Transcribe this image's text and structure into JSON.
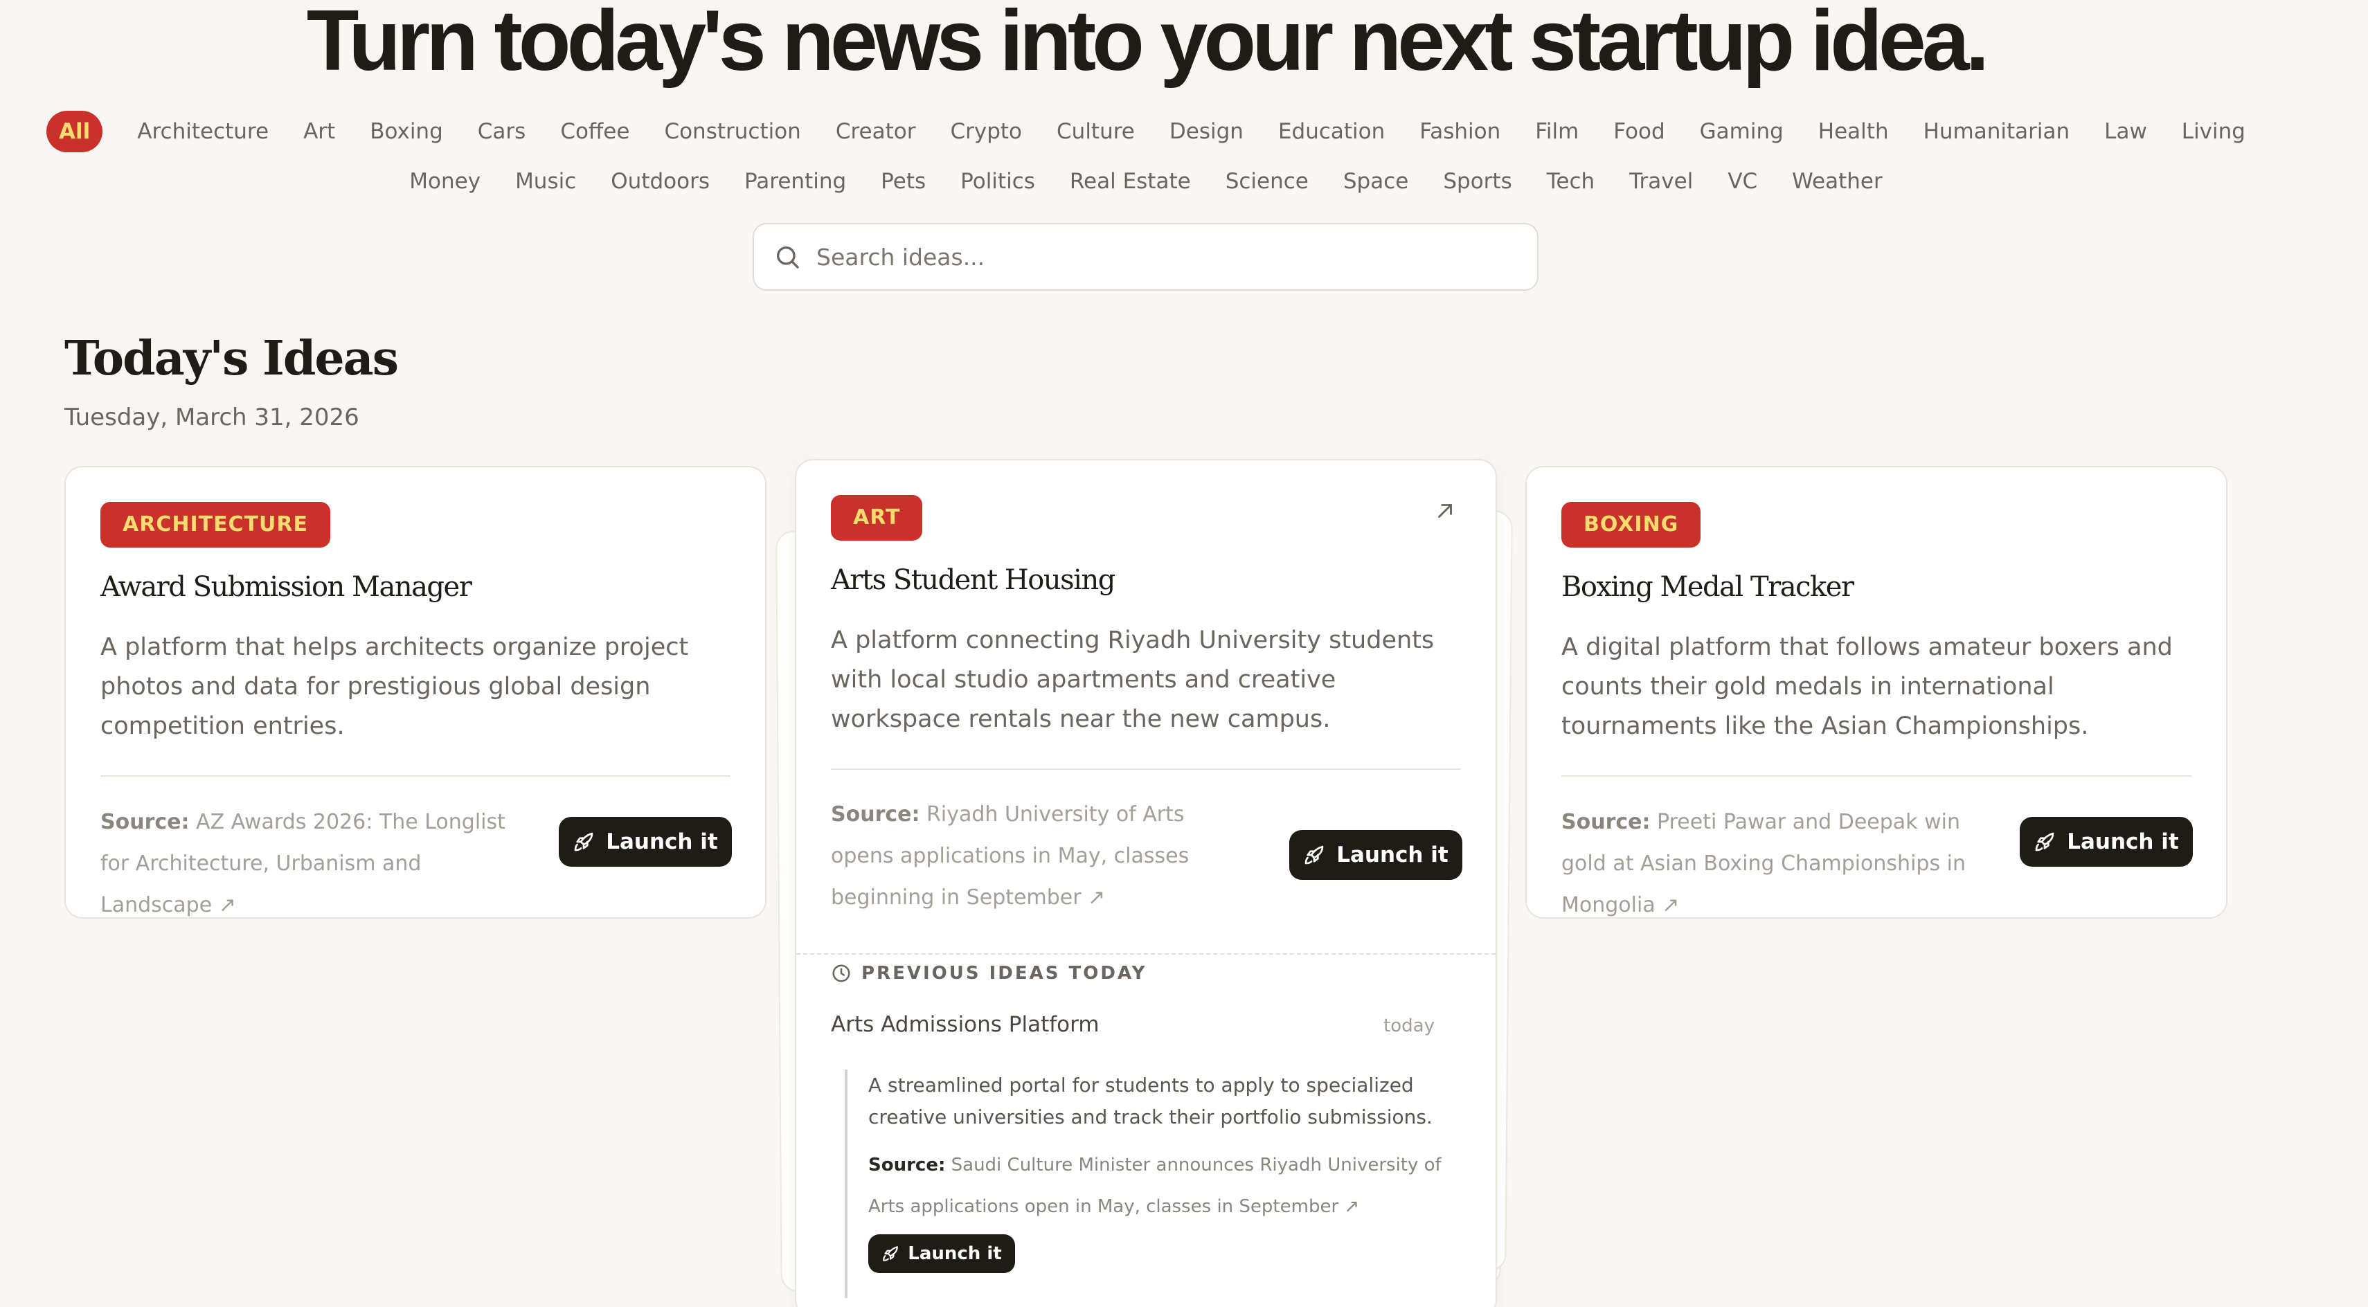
{
  "hero": {
    "title": "Turn today's news into your next startup idea."
  },
  "filters": {
    "row1": [
      "All",
      "Architecture",
      "Art",
      "Boxing",
      "Cars",
      "Coffee",
      "Construction",
      "Creator",
      "Crypto",
      "Culture",
      "Design",
      "Education",
      "Fashion",
      "Film",
      "Food",
      "Gaming",
      "Health",
      "Humanitarian",
      "Law",
      "Living"
    ],
    "row2": [
      "Money",
      "Music",
      "Outdoors",
      "Parenting",
      "Pets",
      "Politics",
      "Real Estate",
      "Science",
      "Space",
      "Sports",
      "Tech",
      "Travel",
      "VC",
      "Weather"
    ],
    "active": "All"
  },
  "search": {
    "placeholder": "Search ideas...",
    "value": ""
  },
  "section": {
    "title": "Today's Ideas",
    "date": "Tuesday, March 31, 2026"
  },
  "source_label": "Source:",
  "launch_label": "Launch it",
  "cards": [
    {
      "badge": "ARCHITECTURE",
      "title": "Award Submission Manager",
      "description": "A platform that helps architects organize project photos and data for prestigious global design competition entries.",
      "source": "AZ Awards 2026: The Longlist for Architecture, Urbanism and Landscape ↗"
    },
    {
      "badge": "ART",
      "title": "Arts Student Housing",
      "description": "A platform connecting Riyadh University students with local studio apartments and creative workspace rentals near the new campus.",
      "source": "Riyadh University of Arts opens applications in May, classes beginning in September ↗"
    },
    {
      "badge": "BOXING",
      "title": "Boxing Medal Tracker",
      "description": "A digital platform that follows amateur boxers and counts their gold medals in international tournaments like the Asian Championships.",
      "source": "Preeti Pawar and Deepak win gold at Asian Boxing Championships in Mongolia ↗"
    }
  ],
  "previous": {
    "header": "PREVIOUS IDEAS TODAY",
    "title": "Arts Admissions Platform",
    "time": "today",
    "description": "A streamlined portal for students to apply to specialized creative universities and track their portfolio submissions.",
    "source": "Saudi Culture Minister announces Riyadh University of Arts applications open in May, classes in September ↗"
  },
  "colors": {
    "accent": "#c9312a",
    "badge_text": "#f7dc6f",
    "button": "#1f1c18",
    "background": "#f8f7f5"
  },
  "icons": [
    "search-icon",
    "rocket-icon",
    "external-arrow-icon",
    "clock-icon"
  ]
}
